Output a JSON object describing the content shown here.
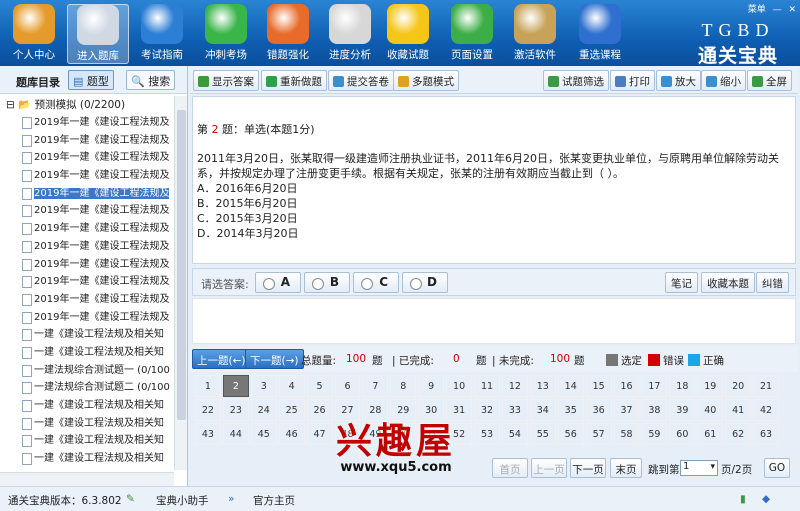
{
  "window": {
    "menu_label": "菜单",
    "brand_line1": "TGBD",
    "brand_line2": "通关宝典"
  },
  "nav": [
    {
      "label": "个人中心",
      "icon": "people-icon",
      "color": "#e59b2b"
    },
    {
      "label": "进入题库",
      "icon": "book-icon",
      "color": "#cfd8e3"
    },
    {
      "label": "考试指南",
      "icon": "globe-icon",
      "color": "#2d7fd6"
    },
    {
      "label": "冲刺考场",
      "icon": "runner-icon",
      "color": "#39b54a"
    },
    {
      "label": "错题强化",
      "icon": "tools-icon",
      "color": "#e86b2a"
    },
    {
      "label": "进度分析",
      "icon": "printer-icon",
      "color": "#d7d7d7"
    },
    {
      "label": "收藏试题",
      "icon": "star-icon",
      "color": "#f5c518"
    },
    {
      "label": "页面设置",
      "icon": "gear-icon",
      "color": "#3dae47"
    },
    {
      "label": "激活软件",
      "icon": "lock-icon",
      "color": "#c7a35a"
    },
    {
      "label": "重选课程",
      "icon": "home-icon",
      "color": "#2f6fcf"
    }
  ],
  "sidebar": {
    "title": "题库目录",
    "btn_type": "题型",
    "btn_search": "搜索",
    "root": "预测模拟 (0/2200)",
    "items": [
      "2019年一建《建设工程法规及",
      "2019年一建《建设工程法规及",
      "2019年一建《建设工程法规及",
      "2019年一建《建设工程法规及",
      "2019年一建《建设工程法规及",
      "2019年一建《建设工程法规及",
      "2019年一建《建设工程法规及",
      "2019年一建《建设工程法规及",
      "2019年一建《建设工程法规及",
      "2019年一建《建设工程法规及",
      "2019年一建《建设工程法规及",
      "2019年一建《建设工程法规及",
      "一建《建设工程法规及相关知",
      "一建《建设工程法规及相关知",
      "一建法规综合测试题一 (0/100",
      "一建法规综合测试题二 (0/100",
      "一建《建设工程法规及相关知",
      "一建《建设工程法规及相关知",
      "一建《建设工程法规及相关知",
      "一建《建设工程法规及相关知",
      "一建《建设工程法规及相关知"
    ],
    "selected_index": 4
  },
  "toolbar": {
    "show_answer": "显示答案",
    "redo": "重新做题",
    "submit": "提交答卷",
    "multi_mode": "多题模式",
    "filter": "试题筛选",
    "print": "打印",
    "zoom_in": "放大",
    "zoom_out": "缩小",
    "fullscreen": "全屏"
  },
  "question": {
    "prefix": "第",
    "number": "2",
    "suffix": "题：单选(本题1分)",
    "text": "2011年3月20日，张某取得一级建造师注册执业证书，2011年6月20日，张某变更执业单位，与原聘用单位解除劳动关系，并按规定办理了注册变更手续。根据有关规定，张某的注册有效期应当截止到（ ）。",
    "options": [
      "A．2016年6月20日",
      "B．2015年6月20日",
      "C．2015年3月20日",
      "D．2014年3月20日"
    ]
  },
  "answer": {
    "prompt": "请选答案:",
    "choices": [
      "A",
      "B",
      "C",
      "D"
    ],
    "note": "笔记",
    "favorite": "收藏本题",
    "report": "纠错"
  },
  "stats": {
    "prev": "上一题(←)",
    "next": "下一题(→)",
    "total_label": "总题量:",
    "total": "100",
    "unit1": "题",
    "done_label": "| 已完成:",
    "done": "0",
    "unit2": "题",
    "undone_label": "| 未完成:",
    "undone": "100",
    "unit3": "题",
    "legend_selected": "选定",
    "legend_wrong": "错误",
    "legend_right": "正确",
    "color_selected": "#777777",
    "color_wrong": "#d40000",
    "color_right": "#1aa7e8"
  },
  "grid": {
    "numbers": [
      "1",
      "2",
      "3",
      "4",
      "5",
      "6",
      "7",
      "8",
      "9",
      "10",
      "11",
      "12",
      "13",
      "14",
      "15",
      "16",
      "17",
      "18",
      "19",
      "20",
      "21",
      "22",
      "23",
      "24",
      "25",
      "26",
      "27",
      "28",
      "29",
      "30",
      "31",
      "32",
      "33",
      "34",
      "35",
      "36",
      "37",
      "38",
      "39",
      "40",
      "41",
      "42",
      "43",
      "44",
      "45",
      "46",
      "47",
      "48",
      "49",
      "50",
      "51",
      "52",
      "53",
      "54",
      "55",
      "56",
      "57",
      "58",
      "59",
      "60",
      "61",
      "62",
      "63"
    ],
    "current": "2"
  },
  "pager": {
    "first": "首页",
    "prev": "上一页",
    "next": "下一页",
    "last": "末页",
    "jump_label": "跳到第",
    "page": "1",
    "total": "页/2页",
    "go": "GO"
  },
  "watermark": {
    "line1": "兴趣屋",
    "line2": "www.xqu5.com"
  },
  "status": {
    "version": "通关宝典版本：6.3.802",
    "assistant": "宝典小助手",
    "homepage": "官方主页"
  }
}
